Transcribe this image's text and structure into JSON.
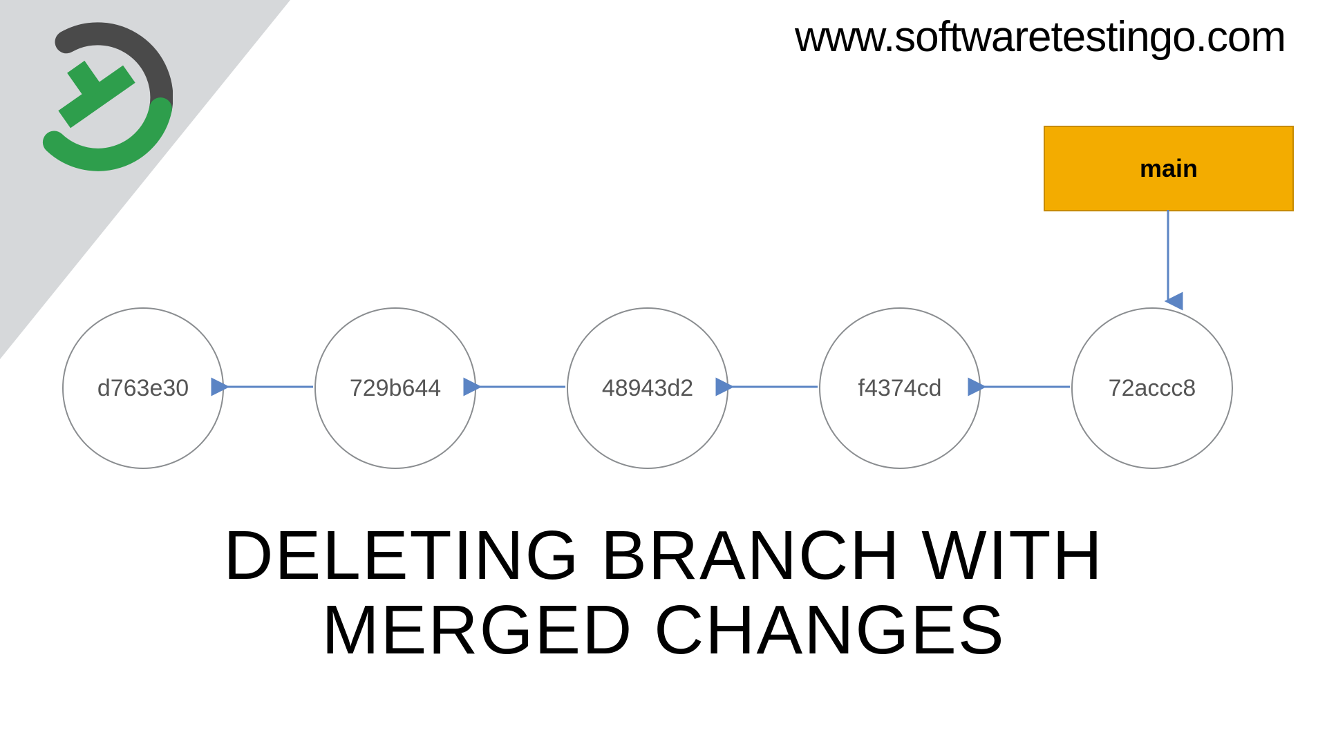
{
  "site_url": "www.softwaretestingo.com",
  "branch_label": "main",
  "commits": [
    {
      "hash": "d763e30"
    },
    {
      "hash": "729b644"
    },
    {
      "hash": "48943d2"
    },
    {
      "hash": "f4374cd"
    },
    {
      "hash": "72accc8"
    }
  ],
  "title_line1": "DELETING BRANCH WITH",
  "title_line2": "MERGED CHANGES",
  "colors": {
    "branch_bg": "#f3ac00",
    "branch_border": "#c68a00",
    "commit_border": "#8a8d90",
    "arrow": "#5b84c4",
    "corner_grey": "#d6d8da",
    "logo_green": "#2e9e4c",
    "logo_dark": "#4a4a4a"
  },
  "diagram": {
    "description": "Linear git history of five commits with main pointing at the newest (rightmost) commit. Arrows point from newer commits to their parents (right to left).",
    "branch_points_to": "72accc8",
    "edges": [
      [
        "729b644",
        "d763e30"
      ],
      [
        "48943d2",
        "729b644"
      ],
      [
        "f4374cd",
        "48943d2"
      ],
      [
        "72accc8",
        "f4374cd"
      ]
    ]
  }
}
